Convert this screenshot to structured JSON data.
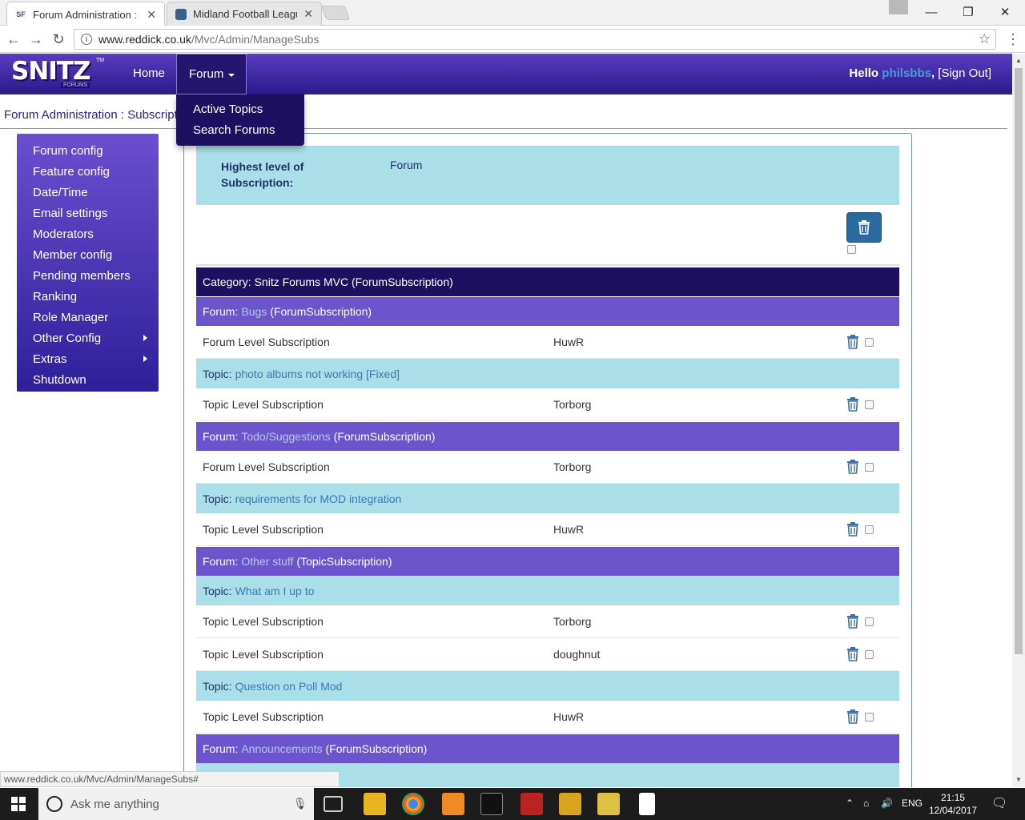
{
  "browser": {
    "tabs": [
      {
        "title": "Forum Administration : S",
        "favicon": "SF"
      },
      {
        "title": "Midland Football League"
      }
    ],
    "url_host": "www.reddick.co.uk",
    "url_path": "/Mvc/Admin/ManageSubs",
    "status_url": "www.reddick.co.uk/Mvc/Admin/ManageSubs#"
  },
  "header": {
    "logo_text": "SNITZ",
    "logo_sub": "FORUMS",
    "logo_tm": "TM",
    "nav_home": "Home",
    "nav_forum": "Forum",
    "hello": "Hello",
    "user": "philsbbs",
    "comma": ",",
    "signout": "[Sign Out]",
    "dropdown": [
      "Active Topics",
      "Search Forums"
    ]
  },
  "breadcrumb": "Forum Administration : Subscriptio",
  "sidebar": {
    "items": [
      {
        "label": "Forum config"
      },
      {
        "label": "Feature config"
      },
      {
        "label": "Date/Time"
      },
      {
        "label": "Email settings"
      },
      {
        "label": "Moderators"
      },
      {
        "label": "Member config"
      },
      {
        "label": "Pending members"
      },
      {
        "label": "Ranking"
      },
      {
        "label": "Role Manager"
      },
      {
        "label": "Other Config"
      },
      {
        "label": "Extras"
      },
      {
        "label": "Shutdown"
      }
    ]
  },
  "main": {
    "highest_level_label": "Highest level of Subscription:",
    "highest_level_value": "Forum",
    "category": {
      "prefix": "Category:",
      "name": "Snitz Forums MVC",
      "type": "(ForumSubscription)"
    },
    "rows": [
      {
        "kind": "forum",
        "prefix": "Forum:",
        "name": "Bugs",
        "type": "(ForumSubscription)"
      },
      {
        "kind": "sub",
        "label": "Forum Level Subscription",
        "member": "HuwR"
      },
      {
        "kind": "topic",
        "prefix": "Topic:",
        "name": "photo albums not working [Fixed]"
      },
      {
        "kind": "sub",
        "label": "Topic Level Subscription",
        "member": "Torborg"
      },
      {
        "kind": "forum",
        "prefix": "Forum:",
        "name": "Todo/Suggestions",
        "type": "(ForumSubscription)"
      },
      {
        "kind": "sub",
        "label": "Forum Level Subscription",
        "member": "Torborg"
      },
      {
        "kind": "topic",
        "prefix": "Topic:",
        "name": "requirements for MOD integration"
      },
      {
        "kind": "sub",
        "label": "Topic Level Subscription",
        "member": "HuwR"
      },
      {
        "kind": "forum",
        "prefix": "Forum:",
        "name": "Other stuff",
        "type": "(TopicSubscription)"
      },
      {
        "kind": "topic",
        "prefix": "Topic:",
        "name": "What am I up to"
      },
      {
        "kind": "sub",
        "label": "Topic Level Subscription",
        "member": "Torborg"
      },
      {
        "kind": "sub",
        "label": "Topic Level Subscription",
        "member": "doughnut"
      },
      {
        "kind": "topic",
        "prefix": "Topic:",
        "name": "Question on Poll Mod"
      },
      {
        "kind": "sub",
        "label": "Topic Level Subscription",
        "member": "HuwR"
      },
      {
        "kind": "forum",
        "prefix": "Forum:",
        "name": "Announcements",
        "type": "(ForumSubscription)"
      },
      {
        "kind": "topic",
        "prefix": "",
        "name": ""
      }
    ]
  },
  "taskbar": {
    "search_placeholder": "Ask me anything",
    "lang": "ENG",
    "time": "21:15",
    "date": "12/04/2017"
  },
  "colors": {
    "header": "#3a25a8",
    "category_row": "#1e1060",
    "forum_row": "#6c55cc",
    "topic_row": "#aadfe9",
    "delete_button": "#2a6a9e"
  }
}
